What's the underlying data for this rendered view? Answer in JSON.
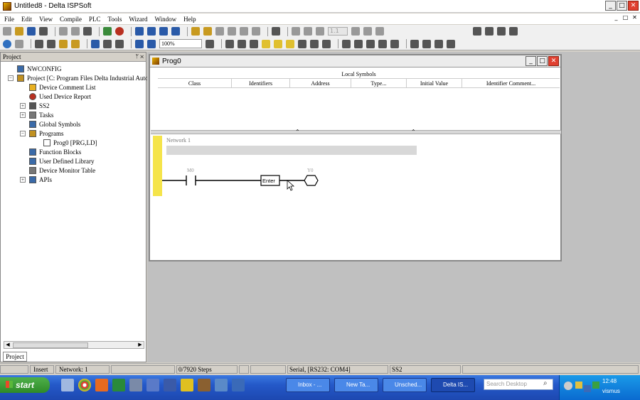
{
  "window": {
    "title": "Untitled8 - Delta ISPSoft"
  },
  "menu": [
    "File",
    "Edit",
    "View",
    "Compile",
    "PLC",
    "Tools",
    "Wizard",
    "Window",
    "Help"
  ],
  "toolbar": {
    "zoom": "100%",
    "step_value": "1.1"
  },
  "project_panel": {
    "title": "Project",
    "tab": "Project",
    "items": [
      {
        "label": "NWCONFIG",
        "level": 0
      },
      {
        "label": "Project [C: Program Files Delta Industrial Autom",
        "level": 0
      },
      {
        "label": "Device Comment List",
        "level": 1
      },
      {
        "label": "Used Device Report",
        "level": 1
      },
      {
        "label": "SS2",
        "level": 1
      },
      {
        "label": "Tasks",
        "level": 1
      },
      {
        "label": "Global Symbols",
        "level": 1
      },
      {
        "label": "Programs",
        "level": 1
      },
      {
        "label": "Prog0 [PRG,LD]",
        "level": 2
      },
      {
        "label": "Function Blocks",
        "level": 1
      },
      {
        "label": "User Defined Library",
        "level": 1
      },
      {
        "label": "Device Monitor Table",
        "level": 1
      },
      {
        "label": "APIs",
        "level": 1
      }
    ]
  },
  "prog_window": {
    "title": "Prog0",
    "local_symbols": {
      "caption": "Local Symbols",
      "columns": [
        "Class",
        "Identifiers",
        "Address",
        "Type...",
        "Initial Value",
        "Identifier Comment..."
      ]
    },
    "network": {
      "label": "Network 1",
      "contact": "M0",
      "coil": "Y0",
      "input_box": "Enter"
    }
  },
  "statusbar": {
    "mode": "Insert",
    "network": "Network: 1",
    "steps": "0/7920 Steps",
    "comm": "Serial, [RS232: COM4]",
    "plc": "SS2"
  },
  "taskbar": {
    "start": "start",
    "tasks": [
      "Inbox - ...",
      "New Ta...",
      "Unsched...",
      "Delta IS..."
    ],
    "search_placeholder": "Search Desktop",
    "clock_time": "12:48",
    "clock_user": "vismus"
  }
}
